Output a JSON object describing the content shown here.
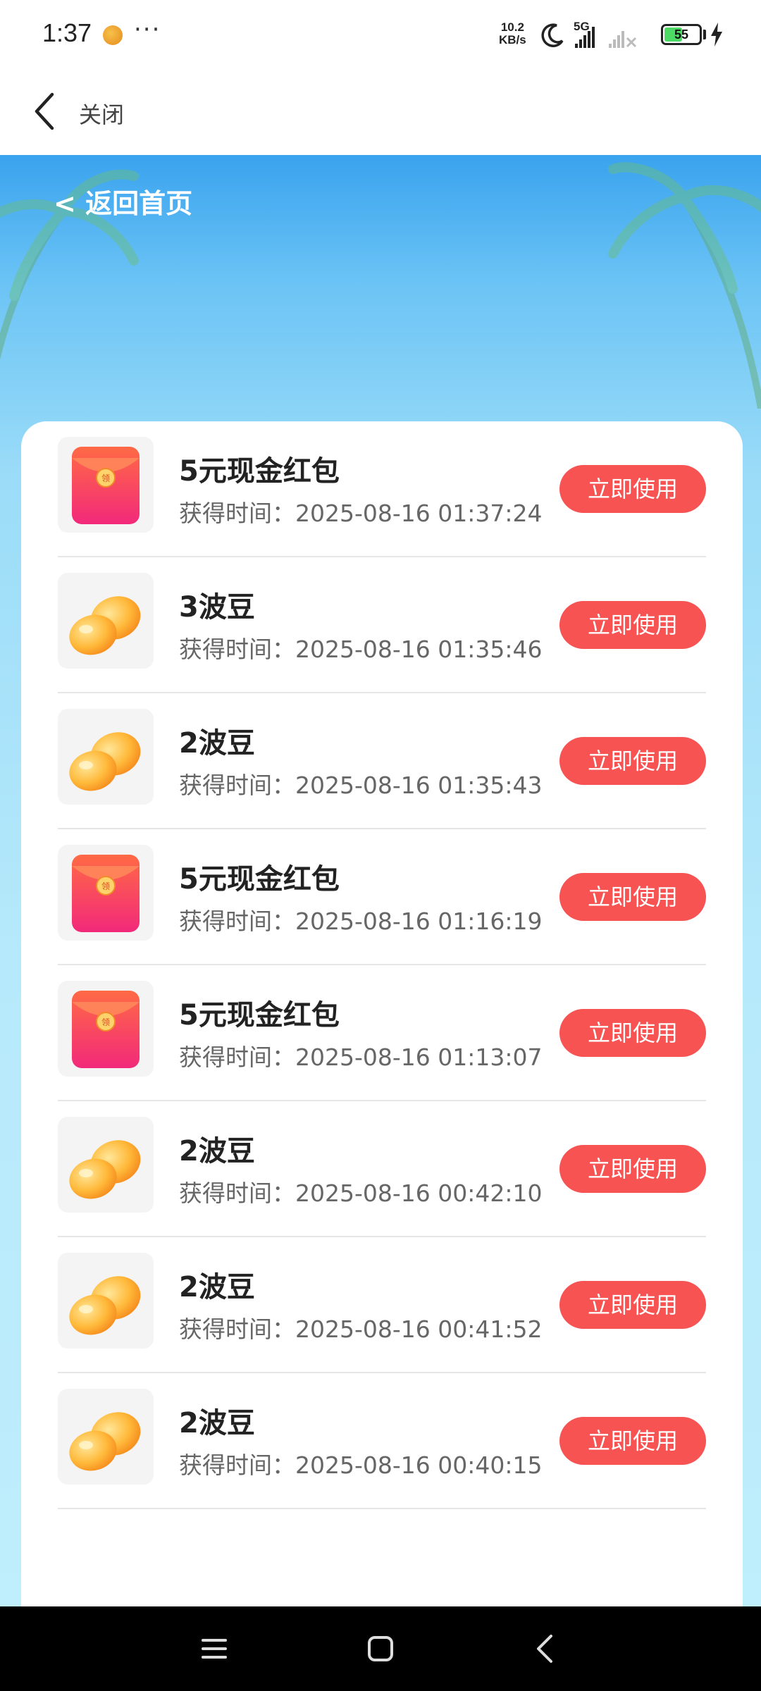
{
  "status_bar": {
    "time": "1:37",
    "dots": "···",
    "net_speed_value": "10.2",
    "net_speed_unit": "KB/s",
    "signal_label": "5G",
    "battery_level": "55",
    "battery_fraction": 0.55
  },
  "title_bar": {
    "close_label": "关闭"
  },
  "hero": {
    "back_home_label": "< 返回首页"
  },
  "rewards": [
    {
      "name": "5元现金红包",
      "time": "获得时间：2025-08-16 01:37:24",
      "button": "立即使用",
      "icon": "red-packet-icon"
    },
    {
      "name": "3波豆",
      "time": "获得时间：2025-08-16 01:35:46",
      "button": "立即使用",
      "icon": "bean-icon"
    },
    {
      "name": "2波豆",
      "time": "获得时间：2025-08-16 01:35:43",
      "button": "立即使用",
      "icon": "bean-icon"
    },
    {
      "name": "5元现金红包",
      "time": "获得时间：2025-08-16 01:16:19",
      "button": "立即使用",
      "icon": "red-packet-icon"
    },
    {
      "name": "5元现金红包",
      "time": "获得时间：2025-08-16 01:13:07",
      "button": "立即使用",
      "icon": "red-packet-icon"
    },
    {
      "name": "2波豆",
      "time": "获得时间：2025-08-16 00:42:10",
      "button": "立即使用",
      "icon": "bean-icon"
    },
    {
      "name": "2波豆",
      "time": "获得时间：2025-08-16 00:41:52",
      "button": "立即使用",
      "icon": "bean-icon"
    },
    {
      "name": "2波豆",
      "time": "获得时间：2025-08-16 00:40:15",
      "button": "立即使用",
      "icon": "bean-icon"
    }
  ],
  "colors": {
    "accent": "#f65352",
    "hero_top": "#3aa3ee",
    "hero_bottom": "#bfeefc"
  }
}
